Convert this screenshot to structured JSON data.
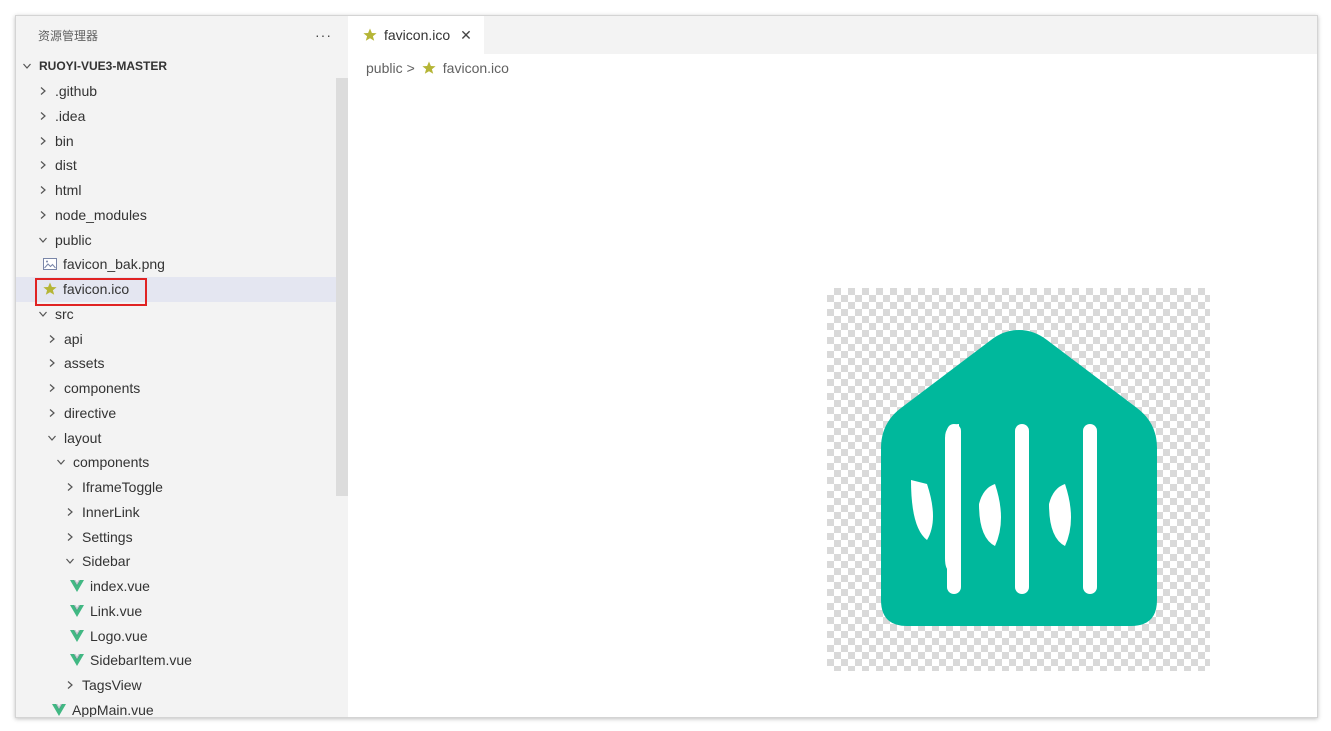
{
  "explorer": {
    "title": "资源管理器",
    "more": "···"
  },
  "tree": [
    {
      "label": "RUOYI-VUE3-MASTER",
      "type": "root",
      "expanded": true,
      "depth": 0
    },
    {
      "label": ".github",
      "type": "folder",
      "expanded": false,
      "depth": 1
    },
    {
      "label": ".idea",
      "type": "folder",
      "expanded": false,
      "depth": 1
    },
    {
      "label": "bin",
      "type": "folder",
      "expanded": false,
      "depth": 1
    },
    {
      "label": "dist",
      "type": "folder",
      "expanded": false,
      "depth": 1
    },
    {
      "label": "html",
      "type": "folder",
      "expanded": false,
      "depth": 1
    },
    {
      "label": "node_modules",
      "type": "folder",
      "expanded": false,
      "depth": 1
    },
    {
      "label": "public",
      "type": "folder",
      "expanded": true,
      "depth": 1
    },
    {
      "label": "favicon_bak.png",
      "type": "image-file",
      "depth": 2
    },
    {
      "label": "favicon.ico",
      "type": "ico-file",
      "depth": 2,
      "selected": true
    },
    {
      "label": "src",
      "type": "folder",
      "expanded": true,
      "depth": 1
    },
    {
      "label": "api",
      "type": "folder",
      "expanded": false,
      "depth": 2
    },
    {
      "label": "assets",
      "type": "folder",
      "expanded": false,
      "depth": 2
    },
    {
      "label": "components",
      "type": "folder",
      "expanded": false,
      "depth": 2
    },
    {
      "label": "directive",
      "type": "folder",
      "expanded": false,
      "depth": 2
    },
    {
      "label": "layout",
      "type": "folder",
      "expanded": true,
      "depth": 2
    },
    {
      "label": "components",
      "type": "folder",
      "expanded": true,
      "depth": 3
    },
    {
      "label": "IframeToggle",
      "type": "folder",
      "expanded": false,
      "depth": 4
    },
    {
      "label": "InnerLink",
      "type": "folder",
      "expanded": false,
      "depth": 4
    },
    {
      "label": "Settings",
      "type": "folder",
      "expanded": false,
      "depth": 4
    },
    {
      "label": "Sidebar",
      "type": "folder",
      "expanded": true,
      "depth": 4
    },
    {
      "label": "index.vue",
      "type": "vue-file",
      "depth": 5
    },
    {
      "label": "Link.vue",
      "type": "vue-file",
      "depth": 5
    },
    {
      "label": "Logo.vue",
      "type": "vue-file",
      "depth": 5
    },
    {
      "label": "SidebarItem.vue",
      "type": "vue-file",
      "depth": 5
    },
    {
      "label": "TagsView",
      "type": "folder",
      "expanded": false,
      "depth": 4
    },
    {
      "label": "AppMain.vue",
      "type": "vue-file",
      "depth": 3
    }
  ],
  "tab": {
    "label": "favicon.ico",
    "close": "✕"
  },
  "breadcrumb": {
    "folder": "public",
    "separator": ">",
    "file": "favicon.ico"
  },
  "colors": {
    "ico_star": "#b5b536",
    "vue_green": "#41b883",
    "logo_teal": "#00b89c",
    "selection_border": "#e02323"
  }
}
